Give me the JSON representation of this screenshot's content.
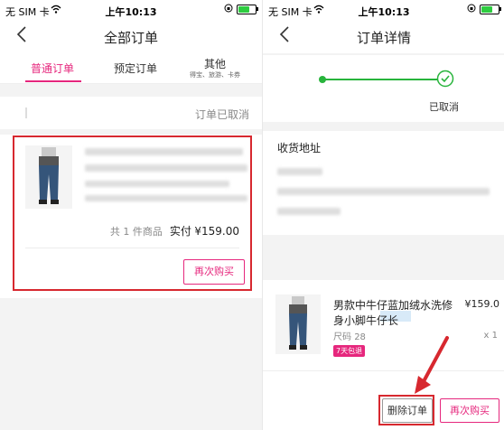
{
  "status_bar": {
    "carrier": "无 SIM 卡",
    "time": "上午10:13"
  },
  "colors": {
    "accent": "#e6277d",
    "highlight_red": "#d7282f",
    "progress_green": "#28b43c"
  },
  "left": {
    "nav_title": "全部订单",
    "tabs": [
      {
        "label": "普通订单",
        "active": true
      },
      {
        "label": "预定订单",
        "active": false
      },
      {
        "label": "其他",
        "sub": "得宝、旅游、卡券",
        "active": false
      }
    ],
    "order_status": "订单已取消",
    "summary": {
      "count_text": "共 1 件商品",
      "pay_label": "实付",
      "amount": "¥159.00"
    },
    "rebuy_button": "再次购买"
  },
  "right": {
    "nav_title": "订单详情",
    "progress_label": "已取消",
    "address_section_title": "收货地址",
    "product": {
      "title": "男款中牛仔蓝加绒水洗修身小脚牛仔长",
      "price": "¥159.0",
      "size_label": "尺码",
      "size_value": "28",
      "qty": "x 1",
      "tag": "7天包退"
    },
    "delete_button": "删除订单",
    "rebuy_button": "再次购买"
  },
  "icons": [
    "back-chevron-icon",
    "wifi-icon",
    "battery-icon",
    "rotation-lock-icon",
    "check-circle-icon",
    "arrow-icon"
  ]
}
